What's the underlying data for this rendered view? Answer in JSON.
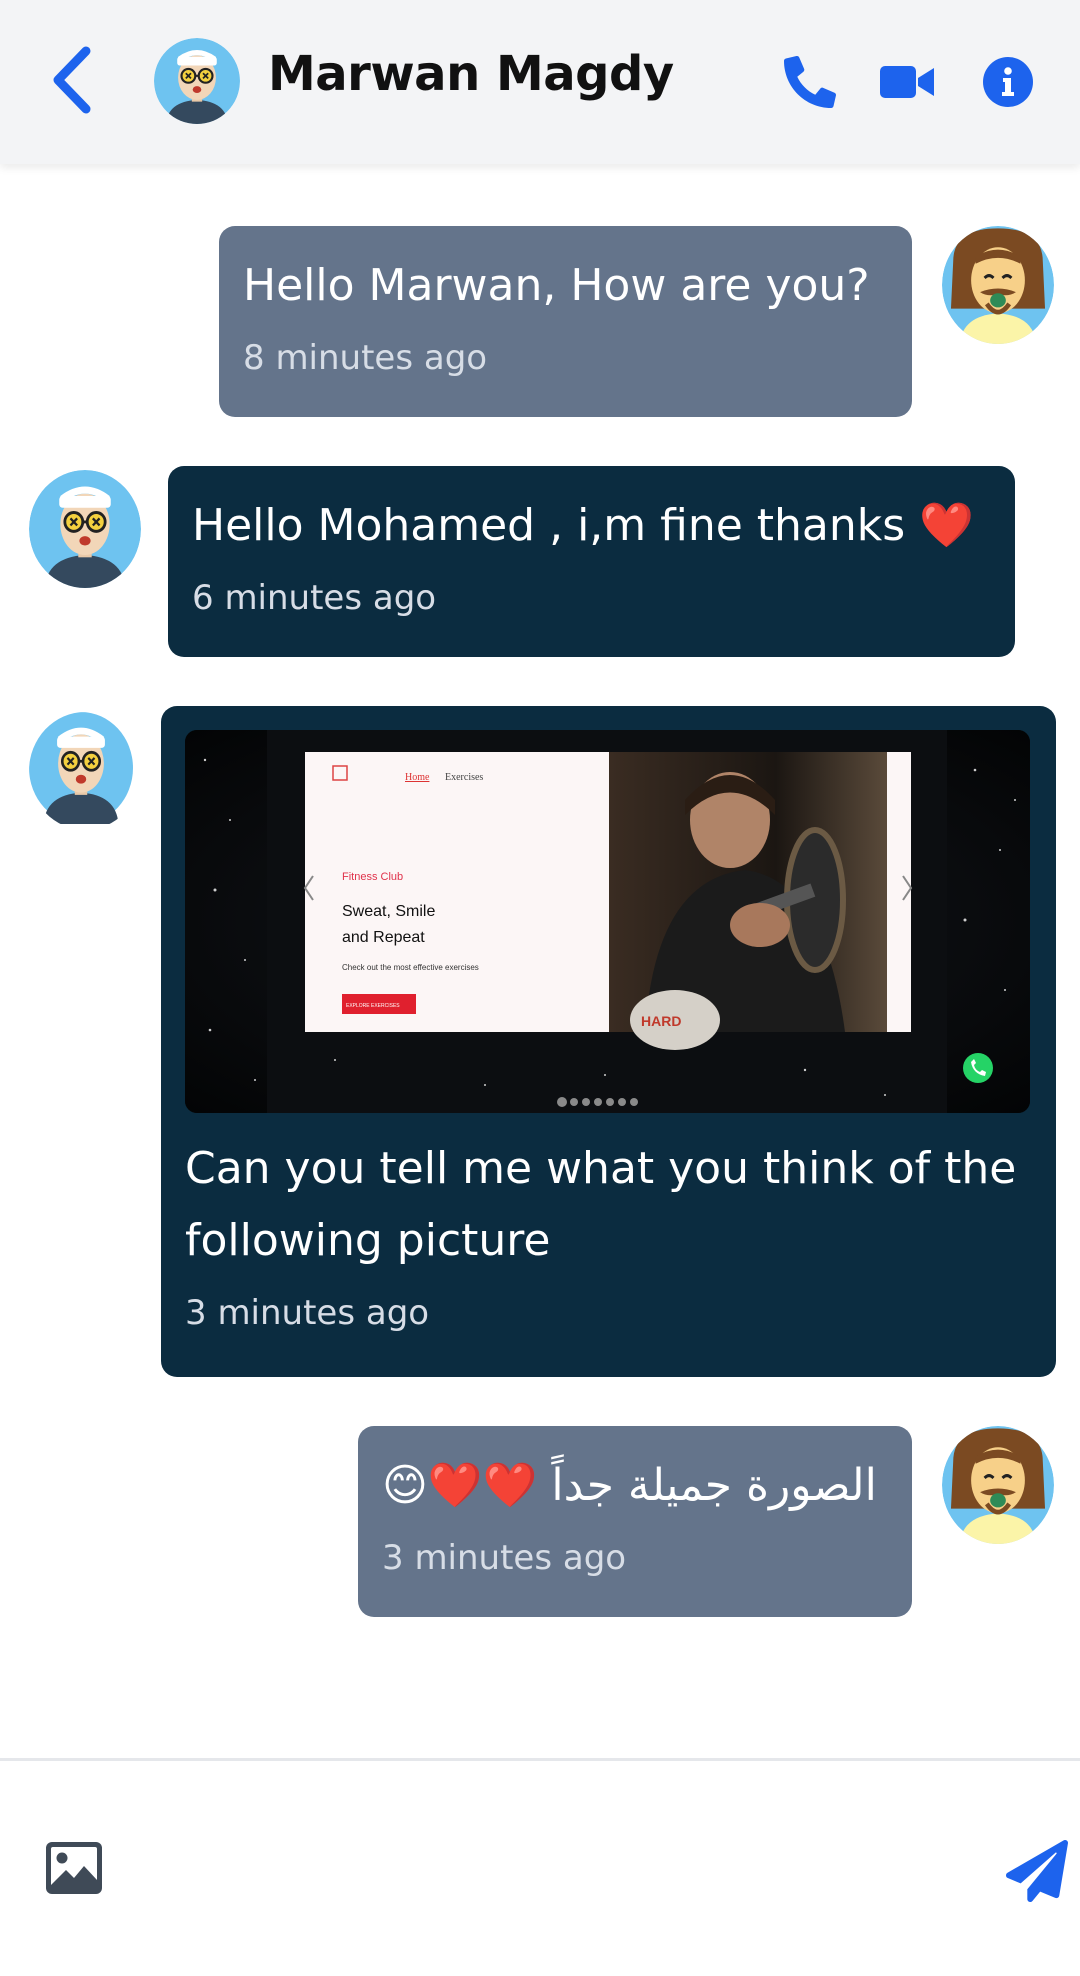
{
  "header": {
    "name": "Marwan Magdy",
    "back_icon": "chevron-left-icon",
    "call_icon": "phone-icon",
    "video_icon": "video-camera-icon",
    "info_icon": "info-icon"
  },
  "messages": [
    {
      "direction": "sent",
      "text": "Hello Marwan, How are you?",
      "time": "8 minutes ago"
    },
    {
      "direction": "received",
      "text": "Hello Mohamed , i,m fine thanks ❤️",
      "time": "6 minutes ago"
    },
    {
      "direction": "received",
      "text": "Can you tell me what you think of the following picture",
      "time": "3 minutes ago",
      "image": {
        "nav_home": "Home",
        "nav_exercises": "Exercises",
        "eyebrow": "Fitness Club",
        "headline_line1": "Sweat, Smile",
        "headline_line2": "and Repeat",
        "subtext": "Check out the most effective exercises",
        "cta": "EXPLORE EXERCISES",
        "shirt_text": "HARD"
      }
    },
    {
      "direction": "sent",
      "text": "الصورة جميلة جداً ❤️❤️😊",
      "time": "3 minutes ago"
    }
  ],
  "composer": {
    "placeholder": "",
    "attach_icon": "image-icon",
    "send_icon": "send-icon"
  },
  "colors": {
    "accent": "#1d63ed",
    "sent_bubble": "#64748b",
    "received_bubble": "#0b2c40",
    "header_bg": "#f3f4f6"
  }
}
